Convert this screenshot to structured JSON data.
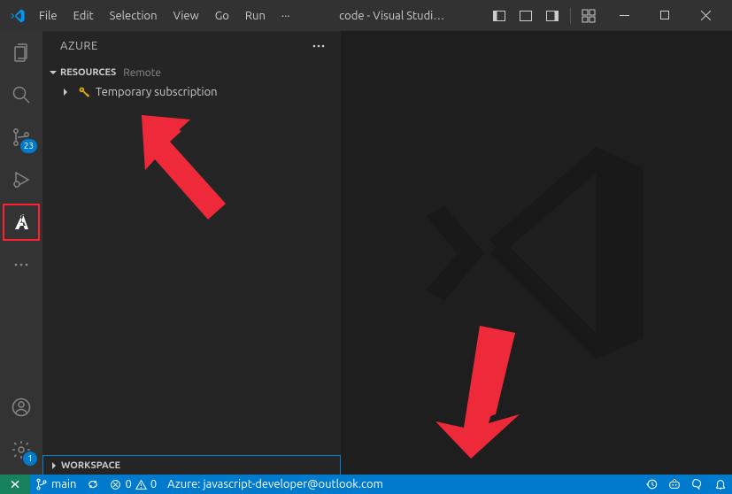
{
  "titlebar": {
    "menu": [
      "File",
      "Edit",
      "Selection",
      "View",
      "Go",
      "Run",
      "···"
    ],
    "title": "code - Visual Studi…"
  },
  "activitybar": {
    "source_control_badge": "23",
    "settings_badge": "1"
  },
  "sidepanel": {
    "title": "AZURE",
    "resources": {
      "label": "RESOURCES",
      "sublabel": "Remote",
      "item_label": "Temporary subscription"
    },
    "workspace": {
      "label": "WORKSPACE"
    }
  },
  "statusbar": {
    "branch": "main",
    "errors": "0",
    "warnings": "0",
    "azure_account": "Azure: javascript-developer@outlook.com"
  }
}
